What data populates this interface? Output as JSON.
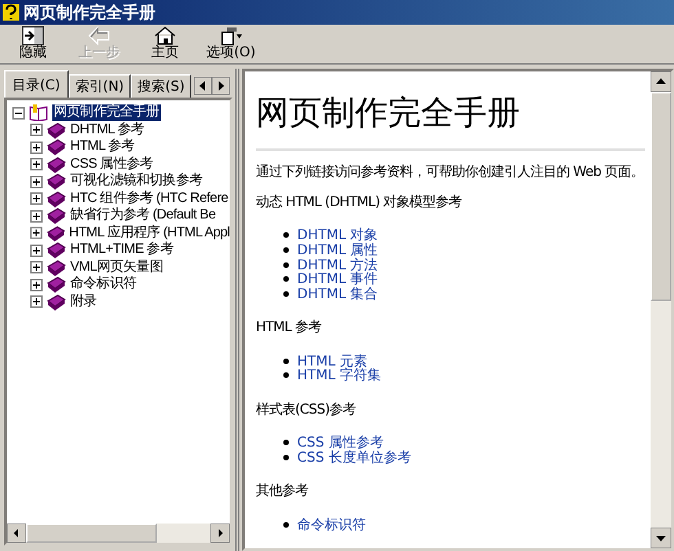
{
  "window": {
    "title": "网页制作完全手册"
  },
  "toolbar": [
    {
      "kind": "hide",
      "label": "隐藏",
      "disabled": false
    },
    {
      "kind": "back",
      "label": "上一步",
      "disabled": true
    },
    {
      "kind": "home",
      "label": "主页",
      "disabled": false
    },
    {
      "kind": "options",
      "label": "选项(O)",
      "disabled": false
    }
  ],
  "tabs": [
    {
      "label": "目录(C)",
      "selected": true
    },
    {
      "label": "索引(N)",
      "selected": false
    },
    {
      "label": "搜索(S)",
      "selected": false
    }
  ],
  "tree": {
    "label": "网页制作完全手册",
    "expanded": true,
    "selected": true,
    "children": [
      {
        "label": "DHTML 参考",
        "expanded": false
      },
      {
        "label": "HTML 参考",
        "expanded": false
      },
      {
        "label": "CSS 属性参考",
        "expanded": false
      },
      {
        "label": "可视化滤镜和切换参考",
        "expanded": false
      },
      {
        "label": "HTC 组件参考 (HTC Refere",
        "expanded": false
      },
      {
        "label": "缺省行为参考 (Default Be",
        "expanded": false
      },
      {
        "label": "HTML 应用程序 (HTML Appl",
        "expanded": false
      },
      {
        "label": "HTML+TIME 参考",
        "expanded": false
      },
      {
        "label": "VML网页矢量图",
        "expanded": false
      },
      {
        "label": "命令标识符",
        "expanded": false
      },
      {
        "label": "附录",
        "expanded": false
      }
    ]
  },
  "content": {
    "title": "网页制作完全手册",
    "intro": "通过下列链接访问参考资料，可帮助你创建引人注目的 Web 页面。",
    "sections": [
      {
        "heading": "动态 HTML (DHTML) 对象模型参考",
        "links": [
          "DHTML 对象",
          "DHTML 属性",
          "DHTML 方法",
          "DHTML 事件",
          "DHTML 集合"
        ]
      },
      {
        "heading": "HTML 参考",
        "links": [
          "HTML 元素",
          "HTML 字符集"
        ]
      },
      {
        "heading": "样式表(CSS)参考",
        "links": [
          "CSS 属性参考",
          "CSS 长度单位参考"
        ]
      },
      {
        "heading": "其他参考",
        "links": [
          "命令标识符"
        ]
      }
    ]
  }
}
